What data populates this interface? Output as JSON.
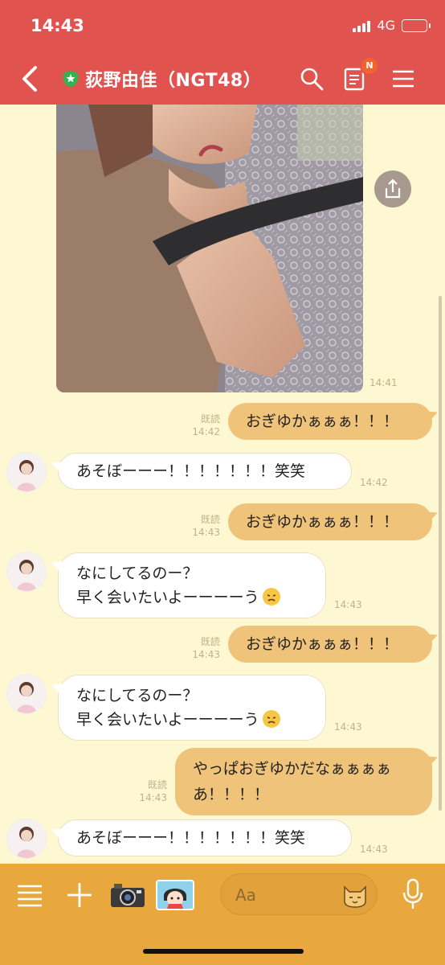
{
  "status": {
    "time": "14:43",
    "network": "4G"
  },
  "header": {
    "title": "荻野由佳（NGT48）",
    "badge": "N"
  },
  "photo": {
    "time": "14:41"
  },
  "messages": [
    {
      "dir": "out",
      "read": "既読",
      "time": "14:42",
      "text": "おぎゆかぁぁぁ！！！"
    },
    {
      "dir": "in",
      "time": "14:42",
      "text": "あそぼーーー！！！！！！！笑笑"
    },
    {
      "dir": "out",
      "read": "既読",
      "time": "14:43",
      "text": "おぎゆかぁぁぁ！！！"
    },
    {
      "dir": "in",
      "time": "14:43",
      "line1": "なにしてるのー？",
      "line2": "早く会いたいよーーーーう"
    },
    {
      "dir": "out",
      "read": "既読",
      "time": "14:43",
      "text": "おぎゆかぁぁぁ！！！"
    },
    {
      "dir": "in",
      "time": "14:43",
      "line1": "なにしてるのー？",
      "line2": "早く会いたいよーーーーう"
    },
    {
      "dir": "out",
      "read": "既読",
      "time": "14:43",
      "line1": "やっぱおぎゆかだなぁぁぁぁ",
      "line2": "あ！！！！"
    },
    {
      "dir": "in",
      "time": "14:43",
      "text": "あそぼーーー！！！！！！！笑笑"
    }
  ],
  "composer": {
    "placeholder": "Aa"
  },
  "icons": [
    "back-chevron-icon",
    "shield-star-icon",
    "search-icon",
    "notes-icon",
    "menu-icon",
    "share-icon",
    "list-icon",
    "plus-icon",
    "camera-icon",
    "sticker-icon",
    "emoji-cat-icon",
    "microphone-icon",
    "sad-face-emoji"
  ],
  "colors": {
    "header": "#e0534f",
    "chat_bg": "#fdf8d2",
    "outgoing_bubble": "#f0c37a",
    "bottom_bar": "#e9a83e"
  }
}
